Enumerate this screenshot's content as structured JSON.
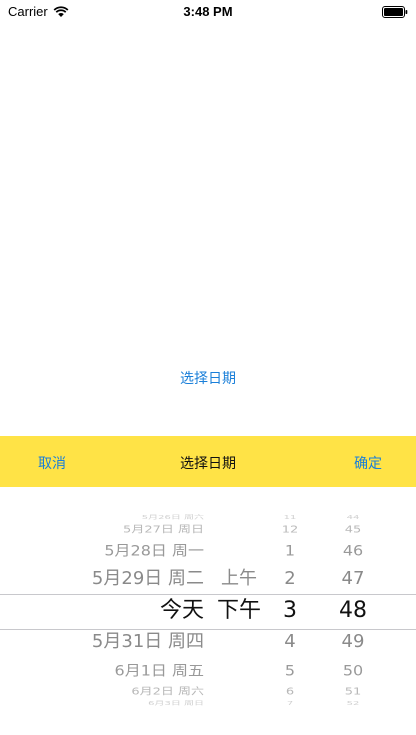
{
  "status_bar": {
    "carrier": "Carrier",
    "time": "3:48 PM",
    "wifi_icon": "wifi-icon",
    "battery_icon": "battery-icon"
  },
  "main": {
    "select_date_link": "选择日期"
  },
  "toolbar": {
    "background": "#ffe346",
    "cancel_label": "取消",
    "title": "选择日期",
    "confirm_label": "确定"
  },
  "picker": {
    "selected_index": 4,
    "rows": [
      {
        "date": "5月26日 周六",
        "ampm": "",
        "hour": "11",
        "minute": "44"
      },
      {
        "date": "5月27日 周日",
        "ampm": "",
        "hour": "12",
        "minute": "45"
      },
      {
        "date": "5月28日 周一",
        "ampm": "",
        "hour": "1",
        "minute": "46"
      },
      {
        "date": "5月29日 周二",
        "ampm": "上午",
        "hour": "2",
        "minute": "47"
      },
      {
        "date": "今天",
        "ampm": "下午",
        "hour": "3",
        "minute": "48"
      },
      {
        "date": "5月31日 周四",
        "ampm": "",
        "hour": "4",
        "minute": "49"
      },
      {
        "date": "6月1日 周五",
        "ampm": "",
        "hour": "5",
        "minute": "50"
      },
      {
        "date": "6月2日 周六",
        "ampm": "",
        "hour": "6",
        "minute": "51"
      },
      {
        "date": "6月3日 周日",
        "ampm": "",
        "hour": "7",
        "minute": "52"
      }
    ]
  }
}
